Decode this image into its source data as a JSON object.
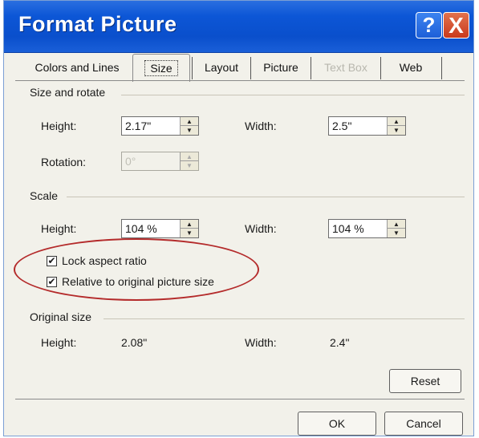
{
  "window": {
    "title": "Format Picture"
  },
  "titlebar_buttons": {
    "help": "?",
    "close": "X"
  },
  "tabs": [
    {
      "label": "Colors and Lines",
      "state": "normal"
    },
    {
      "label": "Size",
      "state": "active"
    },
    {
      "label": "Layout",
      "state": "normal"
    },
    {
      "label": "Picture",
      "state": "normal"
    },
    {
      "label": "Text Box",
      "state": "disabled"
    },
    {
      "label": "Web",
      "state": "normal"
    }
  ],
  "size_and_rotate": {
    "section": "Size and rotate",
    "height_label": "Height:",
    "height_value": "2.17\"",
    "width_label": "Width:",
    "width_value": "2.5\"",
    "rotation_label": "Rotation:",
    "rotation_value": "0°"
  },
  "scale": {
    "section": "Scale",
    "height_label": "Height:",
    "height_value": "104 %",
    "width_label": "Width:",
    "width_value": "104 %",
    "lock_aspect_label": "Lock aspect ratio",
    "lock_aspect_checked": true,
    "relative_label": "Relative to original picture size",
    "relative_checked": true
  },
  "original_size": {
    "section": "Original size",
    "height_label": "Height:",
    "height_value": "2.08\"",
    "width_label": "Width:",
    "width_value": "2.4\""
  },
  "buttons": {
    "reset": "Reset",
    "ok": "OK",
    "cancel": "Cancel"
  },
  "spin_glyphs": {
    "up": "▲",
    "down": "▼"
  },
  "check_glyph": "✔",
  "colors": {
    "titlebar": "#0a4fcc",
    "annotation": "#b42b2b",
    "dialog_bg": "#f2f1ea"
  }
}
